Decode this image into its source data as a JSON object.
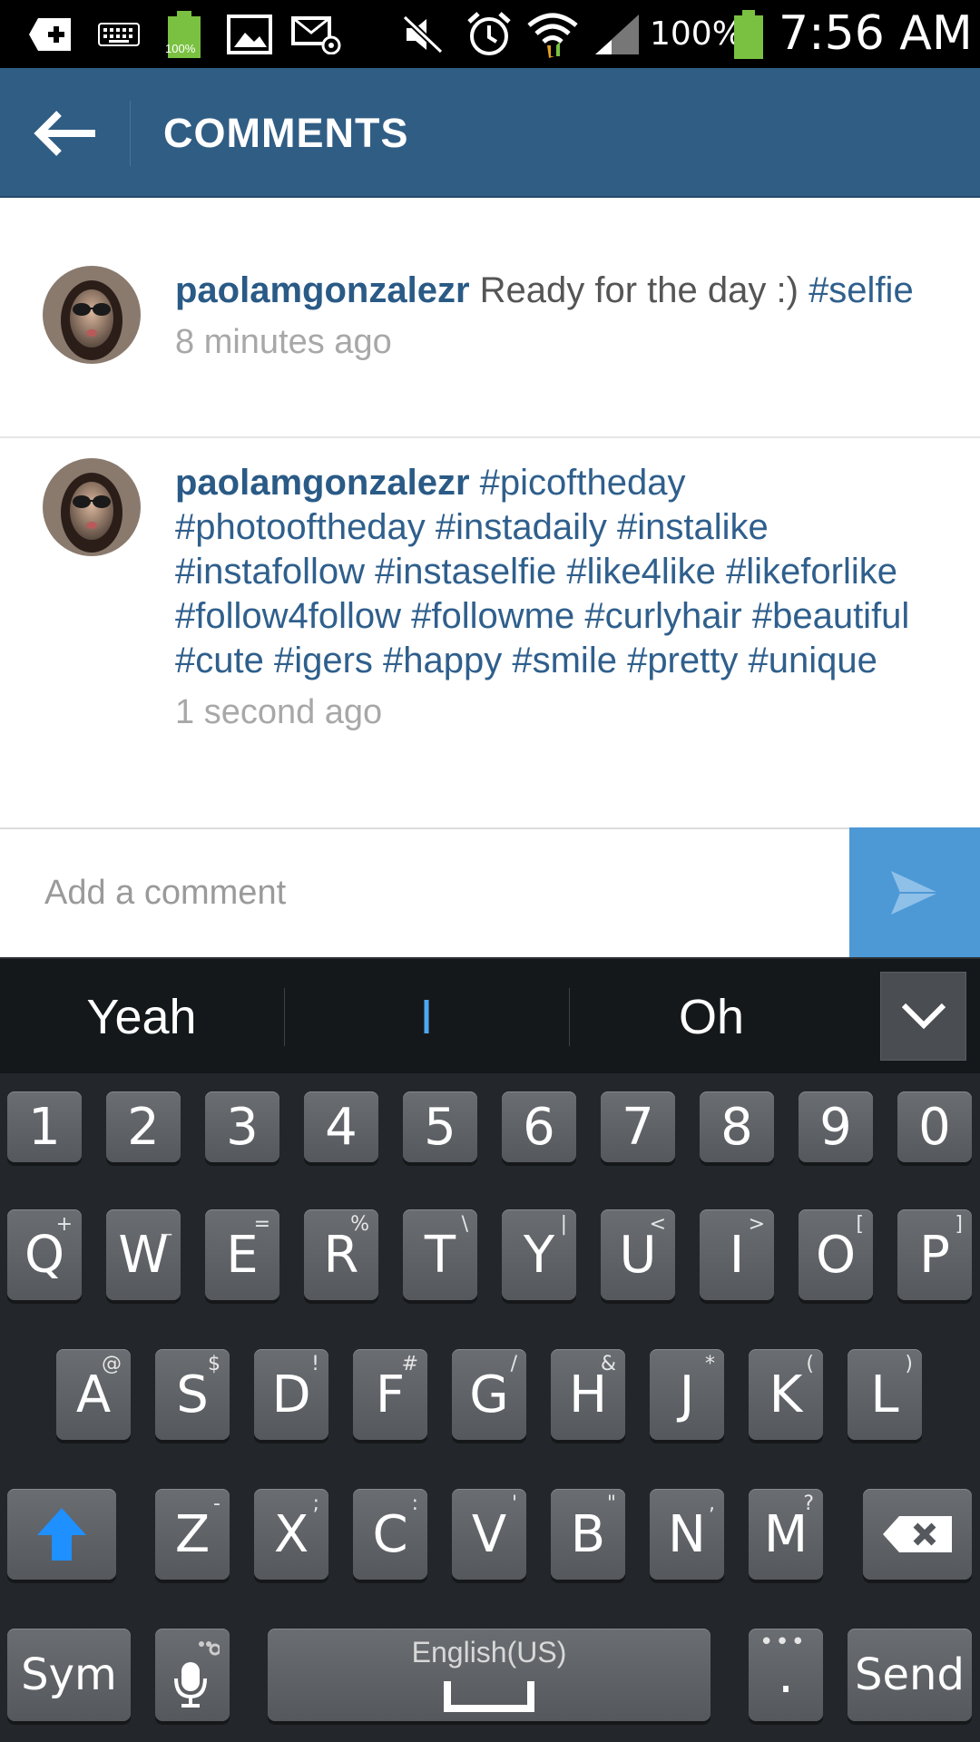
{
  "status_bar": {
    "battery_small_label": "100%",
    "battery_percent": "100%",
    "time": "7:56 AM",
    "icons": [
      "add-icon",
      "keyboard-icon",
      "battery-charging-icon",
      "image-icon",
      "email-icon",
      "mute-icon",
      "alarm-icon",
      "wifi-icon",
      "signal-icon",
      "battery-icon"
    ]
  },
  "header": {
    "title": "COMMENTS",
    "back_icon": "back-arrow-icon",
    "background": "#305d84"
  },
  "comments": [
    {
      "username": "paolamgonzalezr",
      "text": "Ready for the day :)",
      "hashtags": "#selfie",
      "timestamp": "8 minutes ago"
    },
    {
      "username": "paolamgonzalezr",
      "text": "",
      "hashtags": "#picoftheday #photooftheday #instadaily #instalike #instafollow #instaselfie #like4like #likeforlike #follow4follow #followme #curlyhair #beautiful #cute #igers #happy #smile #pretty #unique",
      "timestamp": "1 second ago"
    }
  ],
  "add_comment": {
    "placeholder": "Add a comment",
    "value": "",
    "send_icon": "send-icon",
    "send_color": "#4d99d6"
  },
  "keyboard": {
    "suggestions": [
      "Yeah",
      "I",
      "Oh"
    ],
    "collapse_icon": "chevron-down-icon",
    "number_row": [
      "1",
      "2",
      "3",
      "4",
      "5",
      "6",
      "7",
      "8",
      "9",
      "0"
    ],
    "row1": [
      {
        "main": "Q",
        "sup": "+"
      },
      {
        "main": "W",
        "sup": "_"
      },
      {
        "main": "E",
        "sup": "="
      },
      {
        "main": "R",
        "sup": "%"
      },
      {
        "main": "T",
        "sup": "\\"
      },
      {
        "main": "Y",
        "sup": "|"
      },
      {
        "main": "U",
        "sup": "<"
      },
      {
        "main": "I",
        "sup": ">"
      },
      {
        "main": "O",
        "sup": "["
      },
      {
        "main": "P",
        "sup": "]"
      }
    ],
    "row2": [
      {
        "main": "A",
        "sup": "@"
      },
      {
        "main": "S",
        "sup": "$"
      },
      {
        "main": "D",
        "sup": "!"
      },
      {
        "main": "F",
        "sup": "#"
      },
      {
        "main": "G",
        "sup": "/"
      },
      {
        "main": "H",
        "sup": "&"
      },
      {
        "main": "J",
        "sup": "*"
      },
      {
        "main": "K",
        "sup": "("
      },
      {
        "main": "L",
        "sup": ")"
      }
    ],
    "row3": [
      {
        "main": "Z",
        "sup": "-"
      },
      {
        "main": "X",
        "sup": ";"
      },
      {
        "main": "C",
        "sup": ":"
      },
      {
        "main": "V",
        "sup": "'"
      },
      {
        "main": "B",
        "sup": "\""
      },
      {
        "main": "N",
        "sup": ","
      },
      {
        "main": "M",
        "sup": "?"
      }
    ],
    "shift_icon": "shift-arrow-icon",
    "backspace_icon": "backspace-icon",
    "sym_label": "Sym",
    "mic_icon": "microphone-icon",
    "space_label": "English(US)",
    "period_label": ".",
    "send_label": "Send",
    "accent_color": "#1e90ff"
  }
}
